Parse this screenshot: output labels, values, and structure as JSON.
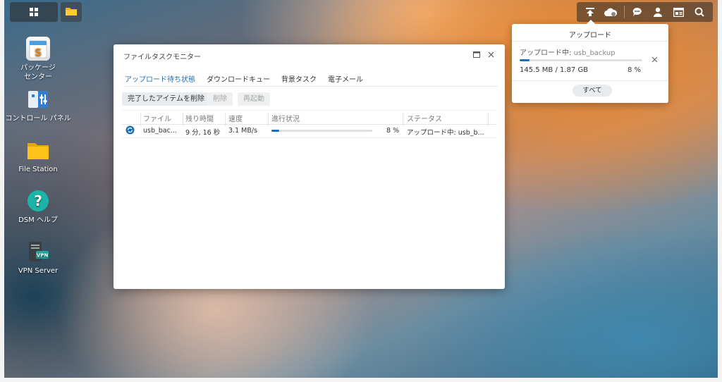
{
  "desktop": {
    "shortcuts": [
      {
        "label": "パッケージ\nセンター",
        "icon": "package-center-icon"
      },
      {
        "label": "コントロール パネル",
        "icon": "control-panel-icon"
      },
      {
        "label": "File Station",
        "icon": "folder-icon"
      },
      {
        "label": "DSM ヘルプ",
        "icon": "help-icon"
      },
      {
        "label": "VPN Server",
        "icon": "vpn-server-icon"
      }
    ]
  },
  "taskbar": {
    "left_icons": [
      "main-menu-icon",
      "file-station-icon"
    ],
    "right_icons": [
      "upload-icon",
      "cloud-icon",
      "chat-icon",
      "user-icon",
      "widgets-icon",
      "search-icon"
    ]
  },
  "window": {
    "title": "ファイルタスクモニター",
    "tabs": [
      "アップロード待ち状態",
      "ダウンロードキュー",
      "背景タスク",
      "電子メール"
    ],
    "active_tab": 0,
    "buttons": {
      "clear_completed": "完了したアイテムを削除",
      "delete": "削除",
      "restart": "再起動"
    },
    "columns": [
      "ファイル",
      "残り時間",
      "速度",
      "進行状況",
      "ステータス"
    ],
    "rows": [
      {
        "file": "usb_bac...",
        "remaining": "9 分, 16 秒",
        "speed": "3.1 MB/s",
        "progress_percent": 8,
        "progress_label": "8 %",
        "status": "アップロード中: usb_b..."
      }
    ]
  },
  "upload_popover": {
    "title": "アップロード",
    "item_label": "アップロード中:",
    "item_name": "usb_backup",
    "size": "145.5 MB / 1.87 GB",
    "percent_label": "8 %",
    "progress_percent": 8,
    "all_button": "すべて"
  },
  "colors": {
    "accent": "#1c6fb3"
  }
}
